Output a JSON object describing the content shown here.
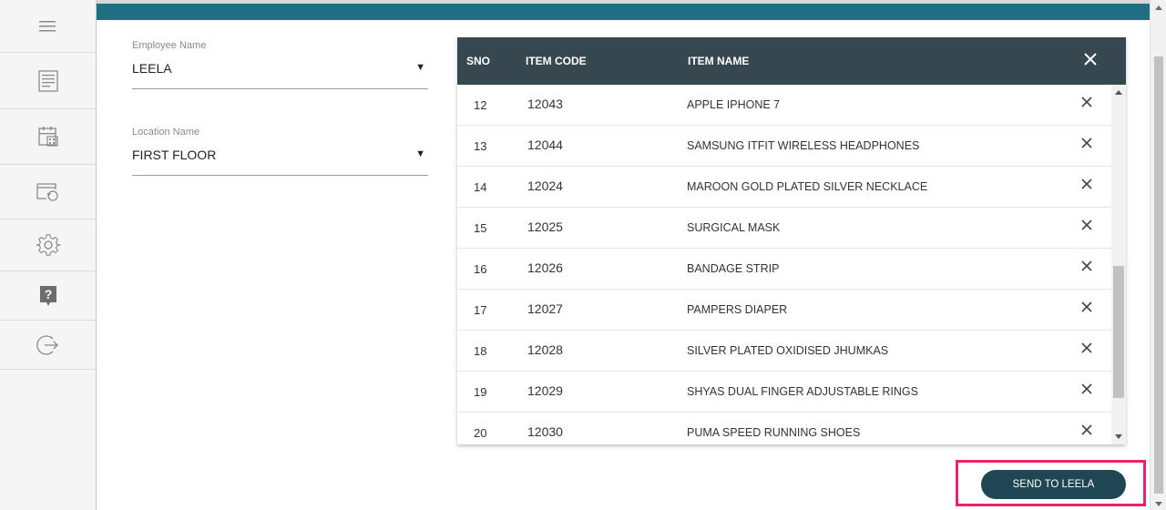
{
  "sidebar": {
    "items": [
      {
        "icon": "menu-icon"
      },
      {
        "icon": "document-list-icon"
      },
      {
        "icon": "calendar-icon"
      },
      {
        "icon": "return-icon"
      },
      {
        "icon": "gear-icon"
      },
      {
        "icon": "help-icon"
      },
      {
        "icon": "logout-icon"
      }
    ]
  },
  "colors": {
    "topbar": "#1f6f82",
    "table_header": "#37474f",
    "button": "#1e4753",
    "highlight": "#e6246a"
  },
  "form": {
    "employee": {
      "label": "Employee Name",
      "value": "LEELA"
    },
    "location": {
      "label": "Location Name",
      "value": "FIRST FLOOR"
    }
  },
  "table": {
    "headers": {
      "sno": "SNO",
      "code": "ITEM CODE",
      "name": "ITEM NAME"
    },
    "rows": [
      {
        "sno": "12",
        "code": "12043",
        "name": "APPLE IPHONE 7"
      },
      {
        "sno": "13",
        "code": "12044",
        "name": "SAMSUNG ITFIT WIRELESS HEADPHONES"
      },
      {
        "sno": "14",
        "code": "12024",
        "name": "MAROON GOLD PLATED SILVER NECKLACE"
      },
      {
        "sno": "15",
        "code": "12025",
        "name": "SURGICAL MASK"
      },
      {
        "sno": "16",
        "code": "12026",
        "name": "BANDAGE STRIP"
      },
      {
        "sno": "17",
        "code": "12027",
        "name": "PAMPERS DIAPER"
      },
      {
        "sno": "18",
        "code": "12028",
        "name": "SILVER PLATED OXIDISED JHUMKAS"
      },
      {
        "sno": "19",
        "code": "12029",
        "name": "SHYAS DUAL FINGER ADJUSTABLE RINGS"
      },
      {
        "sno": "20",
        "code": "12030",
        "name": "PUMA SPEED RUNNING SHOES"
      }
    ]
  },
  "actions": {
    "send_label": "SEND TO LEELA"
  }
}
